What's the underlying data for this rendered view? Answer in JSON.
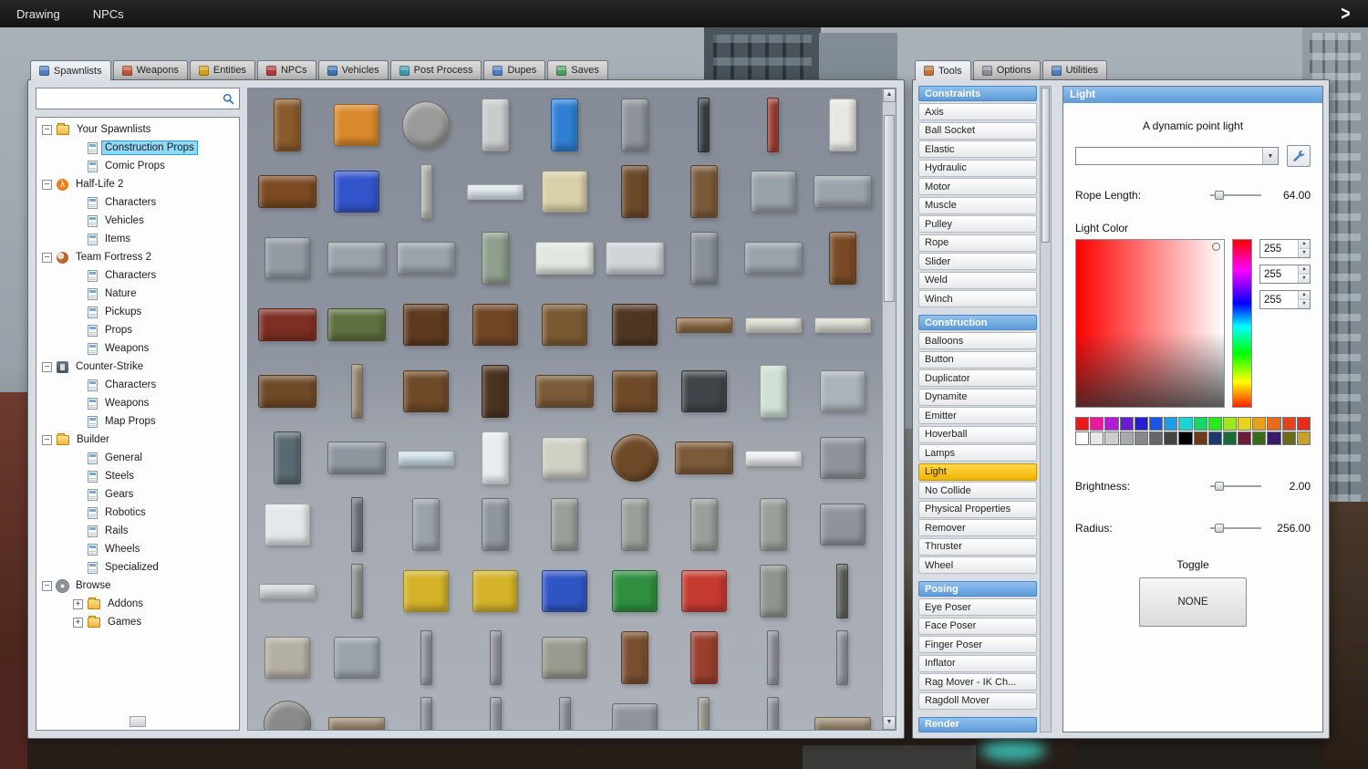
{
  "top_bar": {
    "menus": [
      {
        "label": "Drawing"
      },
      {
        "label": "NPCs"
      }
    ],
    "expand_icon": ">"
  },
  "spawn_panel": {
    "tabs": [
      {
        "label": "Spawnlists",
        "icon": "spawnlists-grid-icon",
        "icon_color": "#4f7fbf",
        "active": true
      },
      {
        "label": "Weapons",
        "icon": "weapons-icon",
        "icon_color": "#c0563a",
        "active": false
      },
      {
        "label": "Entities",
        "icon": "entities-icon",
        "icon_color": "#d4a017",
        "active": false
      },
      {
        "label": "NPCs",
        "icon": "npcs-icon",
        "icon_color": "#b03a3a",
        "active": false
      },
      {
        "label": "Vehicles",
        "icon": "vehicles-icon",
        "icon_color": "#3a76b0",
        "active": false
      },
      {
        "label": "Post Process",
        "icon": "post-process-icon",
        "icon_color": "#3a9fb0",
        "active": false
      },
      {
        "label": "Dupes",
        "icon": "dupes-icon",
        "icon_color": "#4f7fbf",
        "active": false
      },
      {
        "label": "Saves",
        "icon": "saves-icon",
        "icon_color": "#4f9f5f",
        "active": false
      }
    ],
    "search": {
      "value": "",
      "placeholder": ""
    },
    "tree": [
      {
        "label": "Your Spawnlists",
        "icon": "folder",
        "expander": "-",
        "depth": 0
      },
      {
        "label": "Construction Props",
        "icon": "page",
        "depth": 1,
        "selected": true
      },
      {
        "label": "Comic Props",
        "icon": "page",
        "depth": 1
      },
      {
        "label": "Half-Life 2",
        "icon": "hl2",
        "glyph": "λ",
        "expander": "-",
        "depth": 0
      },
      {
        "label": "Characters",
        "icon": "page",
        "depth": 1
      },
      {
        "label": "Vehicles",
        "icon": "page",
        "depth": 1
      },
      {
        "label": "Items",
        "icon": "page",
        "depth": 1
      },
      {
        "label": "Team Fortress 2",
        "icon": "tf2",
        "expander": "-",
        "depth": 0
      },
      {
        "label": "Characters",
        "icon": "page",
        "depth": 1
      },
      {
        "label": "Nature",
        "icon": "page",
        "depth": 1
      },
      {
        "label": "Pickups",
        "icon": "page",
        "depth": 1
      },
      {
        "label": "Props",
        "icon": "page",
        "depth": 1
      },
      {
        "label": "Weapons",
        "icon": "page",
        "depth": 1
      },
      {
        "label": "Counter-Strike",
        "icon": "cs",
        "expander": "-",
        "depth": 0
      },
      {
        "label": "Characters",
        "icon": "page",
        "depth": 1
      },
      {
        "label": "Weapons",
        "icon": "page",
        "depth": 1
      },
      {
        "label": "Map Props",
        "icon": "page",
        "depth": 1
      },
      {
        "label": "Builder",
        "icon": "folder",
        "expander": "-",
        "depth": 0
      },
      {
        "label": "General",
        "icon": "page",
        "depth": 1
      },
      {
        "label": "Steels",
        "icon": "page",
        "depth": 1
      },
      {
        "label": "Gears",
        "icon": "page",
        "depth": 1
      },
      {
        "label": "Robotics",
        "icon": "page",
        "depth": 1
      },
      {
        "label": "Rails",
        "icon": "page",
        "depth": 1
      },
      {
        "label": "Wheels",
        "icon": "page",
        "depth": 1
      },
      {
        "label": "Specialized",
        "icon": "page",
        "depth": 1
      },
      {
        "label": "Browse",
        "icon": "gear",
        "expander": "-",
        "depth": 0
      },
      {
        "label": "Addons",
        "icon": "folder",
        "expander": "+",
        "depth": 1
      },
      {
        "label": "Games",
        "icon": "folder",
        "expander": "+",
        "depth": 1
      }
    ],
    "props": [
      {
        "n": "bar-stool",
        "c": "#8a5a2b",
        "s": "tall"
      },
      {
        "n": "cable-spool",
        "c": "#d9892b",
        "s": "box"
      },
      {
        "n": "wagon-wheel",
        "c": "#9b9b99",
        "s": "round"
      },
      {
        "n": "metal-plate",
        "c": "#c9cccd",
        "s": "tall"
      },
      {
        "n": "blue-barrel",
        "c": "#2f7fd4",
        "s": "tall"
      },
      {
        "n": "jail-door",
        "c": "#8f949c",
        "s": "tall"
      },
      {
        "n": "black-canister",
        "c": "#3a3f45",
        "s": "thin"
      },
      {
        "n": "red-canister",
        "c": "#a03c2f",
        "s": "thin"
      },
      {
        "n": "propane-tank",
        "c": "#e8e8e2",
        "s": "tall"
      },
      {
        "n": "wooden-bench",
        "c": "#7a4a22",
        "s": "wide"
      },
      {
        "n": "blue-chair",
        "c": "#3355cc",
        "s": "box"
      },
      {
        "n": "concrete-pillar",
        "c": "#b9b9b2",
        "s": "thin"
      },
      {
        "n": "glass-pane",
        "c": "#dfe8ee",
        "s": "flat"
      },
      {
        "n": "folded-mattress",
        "c": "#d9cfa8",
        "s": "box"
      },
      {
        "n": "wooden-door",
        "c": "#6b4a2a",
        "s": "tall"
      },
      {
        "n": "glass-door",
        "c": "#7a5a3a",
        "s": "tall"
      },
      {
        "n": "metal-gate",
        "c": "#98a0a8",
        "s": "box"
      },
      {
        "n": "wire-fence",
        "c": "#9aa2aa",
        "s": "wide"
      },
      {
        "n": "metal-frame",
        "c": "#939aa2",
        "s": "box"
      },
      {
        "n": "chainlink-fence",
        "c": "#9aa2aa",
        "s": "wide"
      },
      {
        "n": "wire-gate",
        "c": "#9aa2aa",
        "s": "wide"
      },
      {
        "n": "fountain",
        "c": "#8fa08f",
        "s": "tall"
      },
      {
        "n": "bathtub",
        "c": "#e2e8e0",
        "s": "wide"
      },
      {
        "n": "bunk-bed",
        "c": "#cfd4d8",
        "s": "wide"
      },
      {
        "n": "gas-heater",
        "c": "#8a9098",
        "s": "tall"
      },
      {
        "n": "metal-railing",
        "c": "#9aa2aa",
        "s": "wide"
      },
      {
        "n": "wooden-chair",
        "c": "#7a4a26",
        "s": "tall"
      },
      {
        "n": "red-sofa",
        "c": "#7e2f24",
        "s": "wide"
      },
      {
        "n": "green-sofa",
        "c": "#5f6f3f",
        "s": "wide"
      },
      {
        "n": "wooden-cabinet",
        "c": "#5f3a1f",
        "s": "box"
      },
      {
        "n": "dresser",
        "c": "#6f4526",
        "s": "box"
      },
      {
        "n": "wooden-crate",
        "c": "#7a5a33",
        "s": "box"
      },
      {
        "n": "dark-crate",
        "c": "#503622",
        "s": "box"
      },
      {
        "n": "pallet",
        "c": "#8a6a42",
        "s": "flat"
      },
      {
        "n": "mattress",
        "c": "#d8d8d0",
        "s": "flat"
      },
      {
        "n": "mattress-2",
        "c": "#d8d8d0",
        "s": "flat"
      },
      {
        "n": "coffee-table",
        "c": "#6f4a28",
        "s": "wide"
      },
      {
        "n": "wood-plank",
        "c": "#9a8a72",
        "s": "thin"
      },
      {
        "n": "side-table",
        "c": "#6f4a28",
        "s": "box"
      },
      {
        "n": "tall-cabinet",
        "c": "#4a3320",
        "s": "tall"
      },
      {
        "n": "folding-table",
        "c": "#7a5a38",
        "s": "wide"
      },
      {
        "n": "nightstand",
        "c": "#6f4a28",
        "s": "box"
      },
      {
        "n": "wood-stove",
        "c": "#3f4448",
        "s": "box"
      },
      {
        "n": "fridge",
        "c": "#cfe0d4",
        "s": "tall"
      },
      {
        "n": "radiator",
        "c": "#aab2ba",
        "s": "box"
      },
      {
        "n": "display-case",
        "c": "#5a6a72",
        "s": "tall"
      },
      {
        "n": "bench-frame",
        "c": "#8f969e",
        "s": "wide"
      },
      {
        "n": "glass-shard",
        "c": "#cfe0ea",
        "s": "flat"
      },
      {
        "n": "pedestal-sink",
        "c": "#e8ecef",
        "s": "tall"
      },
      {
        "n": "kitchen-counter",
        "c": "#cfcfc4",
        "s": "box"
      },
      {
        "n": "round-table",
        "c": "#6f4a28",
        "s": "round"
      },
      {
        "n": "small-desk",
        "c": "#7a5a38",
        "s": "wide"
      },
      {
        "n": "paper-sheet",
        "c": "#eef0f2",
        "s": "flat"
      },
      {
        "n": "small-crate",
        "c": "#8f949c",
        "s": "box"
      },
      {
        "n": "washing-machine",
        "c": "#e4e8ea",
        "s": "box"
      },
      {
        "n": "lamp-post",
        "c": "#6f757d",
        "s": "thin"
      },
      {
        "n": "window-frame",
        "c": "#9aa2aa",
        "s": "tall"
      },
      {
        "n": "pipe-rack",
        "c": "#8f969e",
        "s": "tall"
      },
      {
        "n": "gravestone-1",
        "c": "#9a9f9a",
        "s": "tall"
      },
      {
        "n": "gravestone-2",
        "c": "#9a9f9a",
        "s": "tall"
      },
      {
        "n": "gravestone-3",
        "c": "#9a9f9a",
        "s": "tall"
      },
      {
        "n": "gravestone-cross",
        "c": "#9a9f9a",
        "s": "tall"
      },
      {
        "n": "file-cabinet",
        "c": "#8f949c",
        "s": "box"
      },
      {
        "n": "metal-sheet",
        "c": "#d4d8dc",
        "s": "flat"
      },
      {
        "n": "cemetery-cross",
        "c": "#8f948f",
        "s": "thin"
      },
      {
        "n": "cage-yellow-1",
        "c": "#d4b32a",
        "s": "box"
      },
      {
        "n": "cage-yellow-2",
        "c": "#d4b32a",
        "s": "box"
      },
      {
        "n": "cage-blue",
        "c": "#2f55c4",
        "s": "box"
      },
      {
        "n": "cage-green",
        "c": "#2f8f3f",
        "s": "box"
      },
      {
        "n": "cage-red",
        "c": "#c43a2f",
        "s": "box"
      },
      {
        "n": "obelisk",
        "c": "#8f948f",
        "s": "tall"
      },
      {
        "n": "statue",
        "c": "#5f5f58",
        "s": "thin"
      },
      {
        "n": "concrete-lampshade",
        "c": "#b5b0a5",
        "s": "box"
      },
      {
        "n": "lockers",
        "c": "#9aa2aa",
        "s": "box"
      },
      {
        "n": "street-pole",
        "c": "#8f949c",
        "s": "thin"
      },
      {
        "n": "pipe-ladder",
        "c": "#8f949c",
        "s": "thin"
      },
      {
        "n": "u-pipe",
        "c": "#9a9a8f",
        "s": "box"
      },
      {
        "n": "rusty-barrel",
        "c": "#7a4f2f",
        "s": "tall"
      },
      {
        "n": "red-rusty-barrel",
        "c": "#9a3f2f",
        "s": "tall"
      },
      {
        "n": "fence-post",
        "c": "#8f949c",
        "s": "thin"
      },
      {
        "n": "thin-pole",
        "c": "#8f949c",
        "s": "thin"
      },
      {
        "n": "flywheel",
        "c": "#8a8a88",
        "s": "round"
      },
      {
        "n": "wood-board",
        "c": "#9a8a72",
        "s": "flat"
      },
      {
        "n": "pole-a",
        "c": "#8f949c",
        "s": "thin"
      },
      {
        "n": "pole-b",
        "c": "#8f949c",
        "s": "thin"
      },
      {
        "n": "pole-c",
        "c": "#8f949c",
        "s": "thin"
      },
      {
        "n": "gray-crate",
        "c": "#8f949c",
        "s": "box"
      },
      {
        "n": "drain-pipe",
        "c": "#9a9a8f",
        "s": "thin"
      },
      {
        "n": "post",
        "c": "#8f949c",
        "s": "thin"
      },
      {
        "n": "beam",
        "c": "#9a8a72",
        "s": "flat"
      }
    ]
  },
  "tools_panel": {
    "tabs": [
      {
        "label": "Tools",
        "icon": "tools-wrench-icon",
        "icon_color": "#c0763a",
        "active": true
      },
      {
        "label": "Options",
        "icon": "options-gear-icon",
        "icon_color": "#8a9098",
        "active": false
      },
      {
        "label": "Utilities",
        "icon": "utilities-icon",
        "icon_color": "#4f7fbf",
        "active": false
      }
    ],
    "selected_tool": "Light",
    "sections": [
      {
        "title": "Constraints",
        "items": [
          "Axis",
          "Ball Socket",
          "Elastic",
          "Hydraulic",
          "Motor",
          "Muscle",
          "Pulley",
          "Rope",
          "Slider",
          "Weld",
          "Winch"
        ]
      },
      {
        "title": "Construction",
        "items": [
          "Balloons",
          "Button",
          "Duplicator",
          "Dynamite",
          "Emitter",
          "Hoverball",
          "Lamps",
          "Light",
          "No Collide",
          "Physical Properties",
          "Remover",
          "Thruster",
          "Wheel"
        ]
      },
      {
        "title": "Posing",
        "items": [
          "Eye Poser",
          "Face Poser",
          "Finger Poser",
          "Inflator",
          "Rag Mover - IK Ch...",
          "Ragdoll Mover"
        ]
      },
      {
        "title": "Render",
        "items": []
      }
    ],
    "light_tool": {
      "title": "Light",
      "description": "A dynamic point light",
      "preset_value": "",
      "rope_length": {
        "label": "Rope Length:",
        "value": "64.00"
      },
      "light_color_label": "Light Color",
      "rgb": [
        "255",
        "255",
        "255"
      ],
      "palette_rows": [
        [
          "#e81b1b",
          "#e81b9f",
          "#b01bd4",
          "#6a1bd4",
          "#2a1bd4",
          "#1b55e8",
          "#1b9fe8",
          "#1bd4d4",
          "#1bd46a",
          "#2ae81b",
          "#9fe81b",
          "#e8d41b",
          "#e89f1b",
          "#e86a1b",
          "#e8401b",
          "#e82a1b"
        ],
        [
          "#ffffff",
          "#e8e8e8",
          "#cccccc",
          "#aaaaaa",
          "#888888",
          "#666666",
          "#444444",
          "#000000",
          "#6a3a1b",
          "#1b3a6a",
          "#1b6a3a",
          "#6a1b3a",
          "#3a6a1b",
          "#3a1b6a",
          "#6a6a1b",
          "#c8a02a"
        ]
      ],
      "brightness": {
        "label": "Brightness:",
        "value": "2.00"
      },
      "radius": {
        "label": "Radius:",
        "value": "256.00"
      },
      "toggle_label": "Toggle",
      "toggle_button": "NONE",
      "header_color": "#5e9bd8",
      "selected_tool_color": "#efb400"
    }
  }
}
